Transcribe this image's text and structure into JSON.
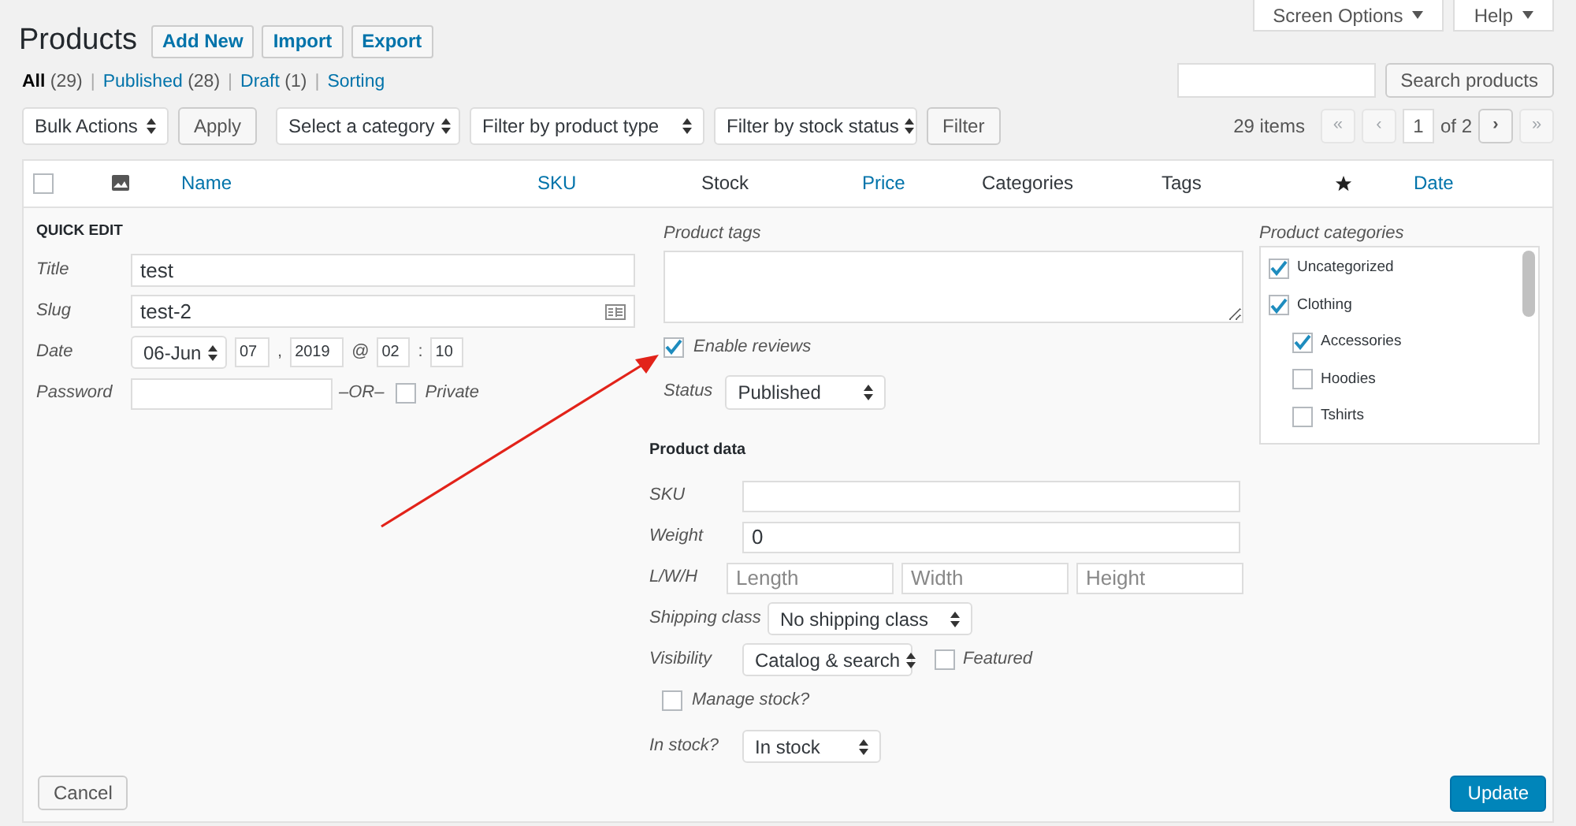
{
  "header": {
    "title": "Products",
    "buttons": [
      "Add New",
      "Import",
      "Export"
    ],
    "tabs": [
      {
        "label": "Screen Options"
      },
      {
        "label": "Help"
      }
    ]
  },
  "views": {
    "separator": "|",
    "items": [
      {
        "label": "All",
        "count": "(29)",
        "selected": true
      },
      {
        "label": "Published",
        "count": "(28)",
        "selected": false
      },
      {
        "label": "Draft",
        "count": "(1)",
        "selected": false
      },
      {
        "label": "Sorting",
        "selected": false
      }
    ]
  },
  "search": {
    "button": "Search products"
  },
  "filters": {
    "bulk_actions": "Bulk Actions",
    "apply": "Apply",
    "selects": [
      "Select a category",
      "Filter by product type",
      "Filter by stock status"
    ],
    "filter_button": "Filter"
  },
  "pagination": {
    "count": "29 items",
    "first": {
      "label": "«",
      "disabled": true
    },
    "prev": {
      "label": "‹",
      "disabled": true
    },
    "current": "1",
    "total": "of 2",
    "next": {
      "label": "›",
      "disabled": false
    },
    "last": {
      "label": "»",
      "disabled": true
    }
  },
  "columns": [
    {
      "kind": "checkbox",
      "checked": false
    },
    {
      "kind": "image"
    },
    {
      "kind": "text",
      "label": "Name",
      "sortable": true
    },
    {
      "kind": "text",
      "label": "SKU",
      "sortable": true
    },
    {
      "kind": "text",
      "label": "Stock",
      "sortable": false
    },
    {
      "kind": "text",
      "label": "Price",
      "sortable": true
    },
    {
      "kind": "text",
      "label": "Categories",
      "sortable": false
    },
    {
      "kind": "text",
      "label": "Tags",
      "sortable": false
    },
    {
      "kind": "star"
    },
    {
      "kind": "text",
      "label": "Date",
      "sortable": true
    }
  ],
  "quick_edit": {
    "heading": "QUICK EDIT",
    "title": {
      "label": "Title",
      "value": "test"
    },
    "slug": {
      "label": "Slug",
      "value": "test-2"
    },
    "date": {
      "label": "Date",
      "month": "06-Jun",
      "day": "07",
      "comma": ",",
      "year": "2019",
      "at": "@",
      "hour": "02",
      "colon": ":",
      "minute": "10"
    },
    "password": {
      "label": "Password",
      "or": "–OR–",
      "private_label": "Private",
      "private_checked": false
    },
    "tags": {
      "label": "Product tags"
    },
    "enable_reviews": {
      "label": "Enable reviews",
      "checked": true
    },
    "status": {
      "label": "Status",
      "value": "Published"
    },
    "product_data": {
      "heading": "Product data",
      "sku": {
        "label": "SKU"
      },
      "weight": {
        "label": "Weight",
        "value": "0"
      },
      "dimensions": {
        "label": "L/W/H",
        "placeholders": [
          "Length",
          "Width",
          "Height"
        ]
      },
      "shipping_class": {
        "label": "Shipping class",
        "value": "No shipping class"
      },
      "visibility": {
        "label": "Visibility",
        "value": "Catalog & search"
      },
      "featured": {
        "label": "Featured",
        "checked": false
      },
      "manage_stock": {
        "label": "Manage stock?",
        "checked": false
      },
      "in_stock": {
        "label": "In stock?",
        "value": "In stock"
      }
    },
    "categories": {
      "label": "Product categories",
      "items": [
        {
          "label": "Uncategorized",
          "checked": true
        },
        {
          "label": "Clothing",
          "checked": true,
          "children": [
            {
              "label": "Accessories",
              "checked": true
            },
            {
              "label": "Hoodies",
              "checked": false
            },
            {
              "label": "Tshirts",
              "checked": false
            }
          ]
        }
      ]
    },
    "cancel": "Cancel",
    "update": "Update"
  }
}
